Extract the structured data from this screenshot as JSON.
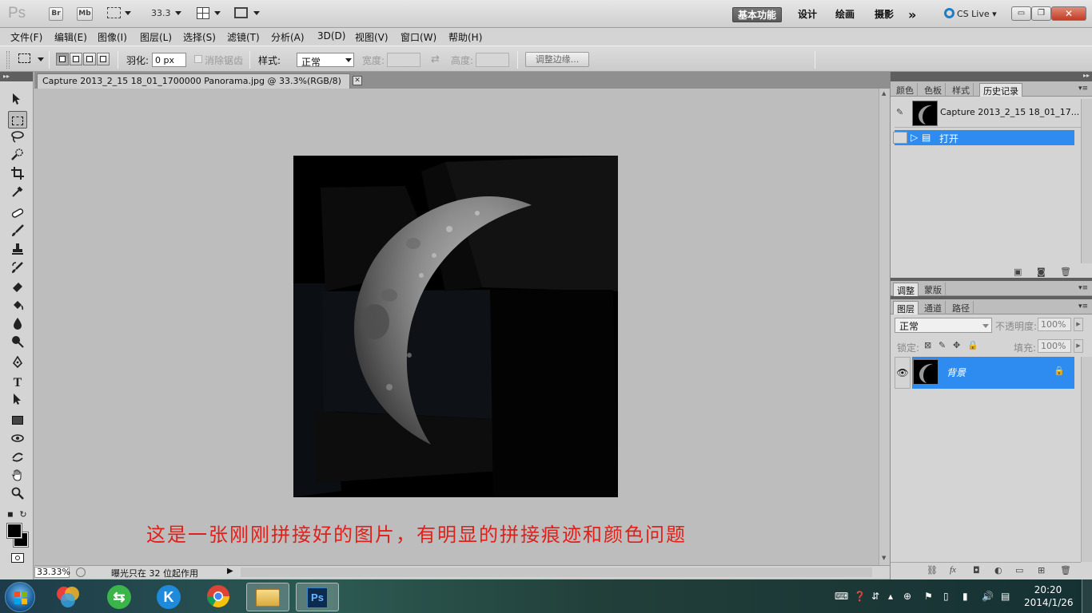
{
  "app_bar": {
    "logo": "Ps",
    "bridge_label": "Br",
    "minibridge_label": "Mb",
    "zoom_value": "33.3",
    "workspaces": [
      "基本功能",
      "设计",
      "绘画",
      "摄影"
    ],
    "more_label": "»",
    "cslive_label": "CS Live",
    "minimize": "▭",
    "restore": "❐",
    "close": "✕"
  },
  "menubar": {
    "items": [
      "文件(F)",
      "编辑(E)",
      "图像(I)",
      "图层(L)",
      "选择(S)",
      "滤镜(T)",
      "分析(A)",
      "3D(D)",
      "视图(V)",
      "窗口(W)",
      "帮助(H)"
    ]
  },
  "options": {
    "feather_label": "羽化:",
    "feather_value": "0 px",
    "antialias_label": "消除锯齿",
    "style_label": "样式:",
    "style_value": "正常",
    "width_label": "宽度:",
    "height_label": "高度:",
    "refine_edge_label": "调整边缘..."
  },
  "document": {
    "tab_title": "Capture 2013_2_15 18_01_1700000 Panorama.jpg @ 33.3%(RGB/8)",
    "tab_close": "✕",
    "annotation": "这是一张刚刚拼接好的图片，有明显的拼接痕迹和颜色问题"
  },
  "status": {
    "zoom": "33.33%",
    "message": "曝光只在 32 位起作用"
  },
  "panels": {
    "top_tabs": [
      "颜色",
      "色板",
      "样式",
      "历史记录"
    ],
    "history_snapshot": "Capture 2013_2_15 18_01_17...",
    "history_item": "打开",
    "adjust_tabs": [
      "调整",
      "蒙版"
    ],
    "layer_tabs": [
      "图层",
      "通道",
      "路径"
    ],
    "blend_mode": "正常",
    "opacity_label": "不透明度:",
    "opacity_value": "100%",
    "lock_label": "锁定:",
    "fill_label": "填充:",
    "fill_value": "100%",
    "layer_name": "背景"
  },
  "taskbar": {
    "time": "20:20",
    "date": "2014/1/26",
    "ps_label": "Ps",
    "k_label": "K"
  }
}
